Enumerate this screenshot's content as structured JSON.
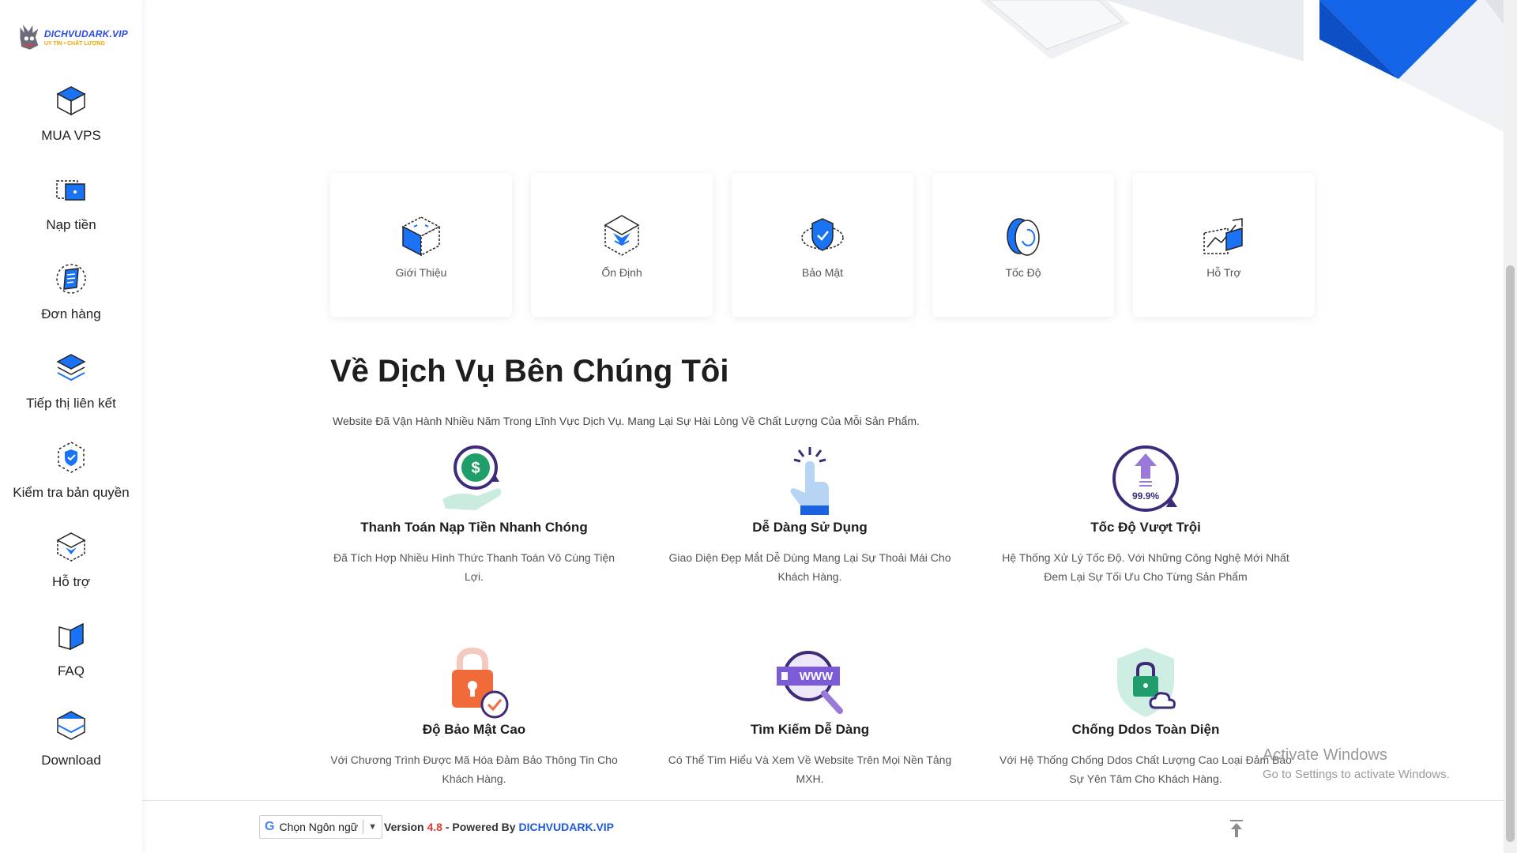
{
  "brand": {
    "logo_title": "DICHVUDARK.VIP",
    "logo_subtitle": "UY TÍN • CHẤT LƯỢNG"
  },
  "sidebar": {
    "items": [
      {
        "label": "MUA VPS",
        "icon": "cube-icon"
      },
      {
        "label": "Nạp tiền",
        "icon": "wallet-icon"
      },
      {
        "label": "Đơn hàng",
        "icon": "order-icon"
      },
      {
        "label": "Tiếp thị liên kết",
        "icon": "layers-icon"
      },
      {
        "label": "Kiểm tra bản quyền",
        "icon": "shield-check-icon"
      },
      {
        "label": "Hỗ trợ",
        "icon": "support-icon"
      },
      {
        "label": "FAQ",
        "icon": "book-icon"
      },
      {
        "label": "Download",
        "icon": "download-icon"
      }
    ]
  },
  "cards": [
    {
      "label": "Giới Thiệu"
    },
    {
      "label": "Ổn Định"
    },
    {
      "label": "Bảo Mật"
    },
    {
      "label": "Tốc Độ"
    },
    {
      "label": "Hỗ Trợ"
    }
  ],
  "about": {
    "title": "Về Dịch Vụ Bên Chúng Tôi",
    "description": "Website Đã Vận Hành Nhiều Năm Trong Lĩnh Vực Dịch Vụ. Mang Lại Sự Hài Lòng Về Chất Lượng Của Mỗi Sản Phẩm."
  },
  "features": [
    {
      "title": "Thanh Toán Nạp Tiền Nhanh Chóng",
      "text": "Đã Tích Hợp Nhiều Hình Thức Thanh Toán Vô Cùng Tiện Lợi."
    },
    {
      "title": "Dễ Dàng Sử Dụng",
      "text": "Giao Diện Đẹp Mắt Dễ Dùng Mang Lại Sự Thoải Mái Cho Khách Hàng."
    },
    {
      "title": "Tốc Độ Vượt Trội",
      "text": "Hệ Thống Xử Lý Tốc Độ. Với Những Công Nghệ Mới Nhất Đem Lại Sự Tối Ưu Cho Từng Sản Phẩm",
      "icon_text": "99.9%"
    },
    {
      "title": "Độ Bảo Mật Cao",
      "text": "Với Chương Trình Được Mã Hóa Đảm Bảo Thông Tin Cho Khách Hàng."
    },
    {
      "title": "Tìm Kiếm Dễ Dàng",
      "text": "Có Thể Tìm Hiểu Và Xem Về Website Trên Mọi Nền Tảng MXH.",
      "icon_text": "WWW"
    },
    {
      "title": "Chống Ddos Toàn Diện",
      "text": "Với Hệ Thống Chống Ddos Chất Lượng Cao Loại Đảm Bảo Sự Yên Tâm Cho Khách Hàng."
    }
  ],
  "footer": {
    "language_label": "Chọn Ngôn ngữ",
    "version_prefix": "Version",
    "version": "4.8",
    "powered_by": "- Powered By",
    "brand_link": "DICHVUDARK.VIP"
  },
  "watermark": {
    "line1": "Activate Windows",
    "line2": "Go to Settings to activate Windows."
  },
  "colors": {
    "accent": "#1e5bd8",
    "icon_blue": "#1a73f5",
    "version_red": "#e53935"
  }
}
